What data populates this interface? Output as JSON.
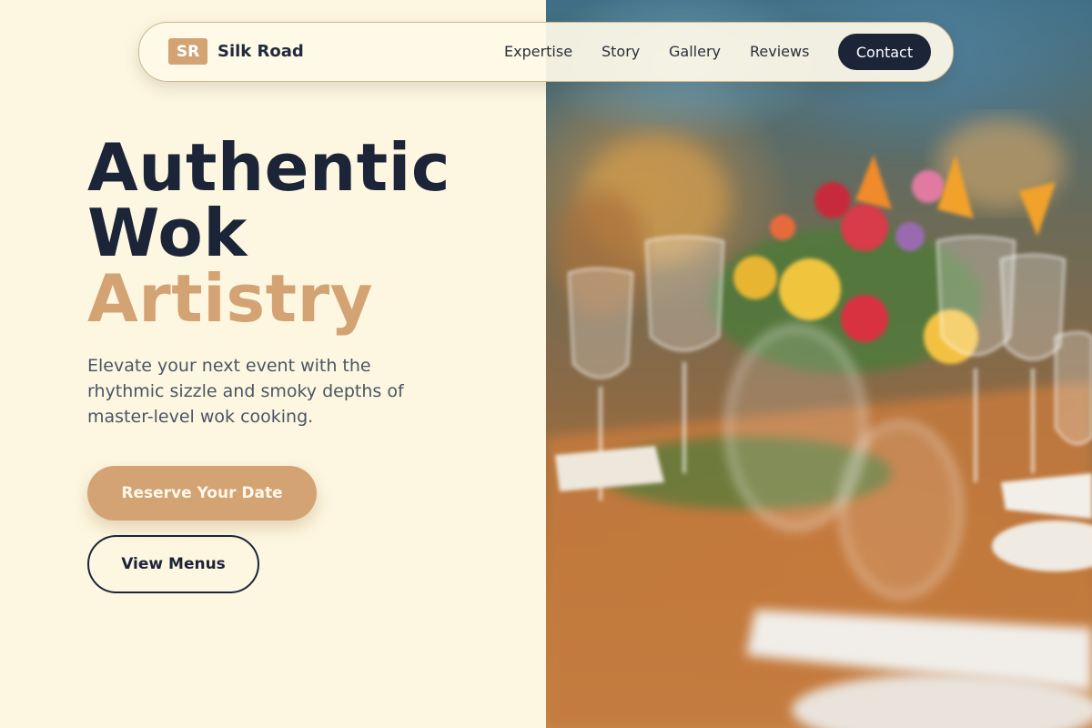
{
  "nav": {
    "badge": "SR",
    "brand": "Silk Road",
    "links": [
      "Expertise",
      "Story",
      "Gallery",
      "Reviews"
    ],
    "contact": "Contact"
  },
  "hero": {
    "line1": "Authentic",
    "line2": "Wok",
    "line3": "Artistry",
    "subtitle": "Elevate your next event with the rhythmic sizzle and smoky depths of master-level wok cooking.",
    "primary_cta": "Reserve Your Date",
    "secondary_cta": "View Menus"
  },
  "colors": {
    "accent": "#d4a373",
    "dark": "#1c2438",
    "background": "#fdf7e1"
  }
}
